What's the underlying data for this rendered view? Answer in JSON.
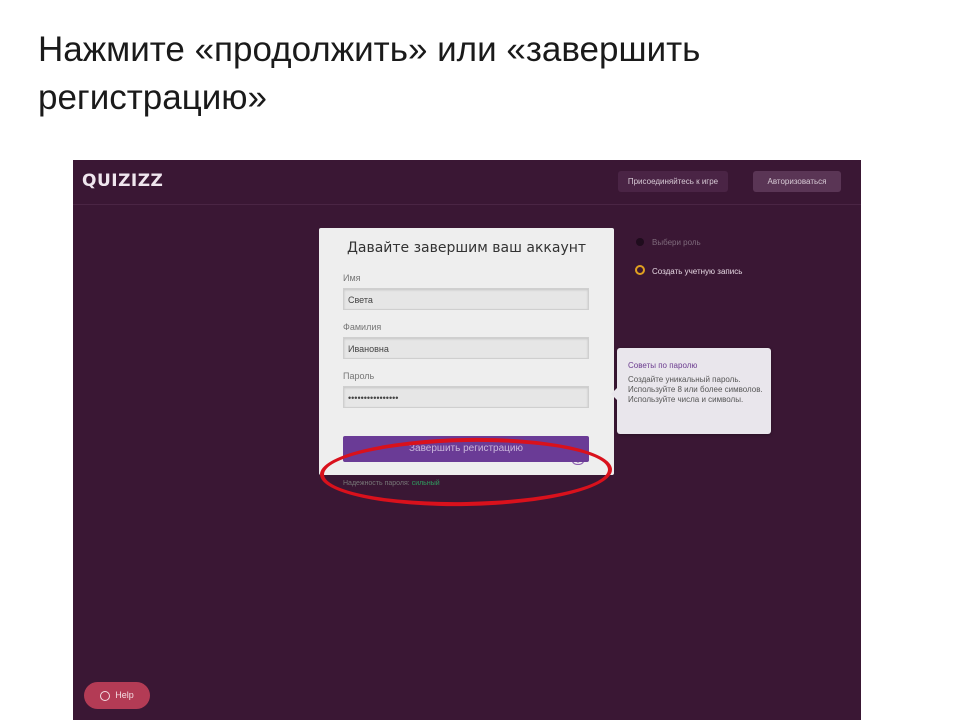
{
  "slide": {
    "title": "Нажмите «продолжить» или  «завершить регистрацию»"
  },
  "app": {
    "logo": "QUIZIZZ",
    "join_button": "Присоединяйтесь к игре",
    "login_button": "Авторизоваться"
  },
  "form": {
    "title": "Давайте завершим ваш аккаунт",
    "first_name_label": "Имя",
    "first_name_value": "Света",
    "last_name_label": "Фамилия",
    "last_name_value": "Ивановна",
    "password_label": "Пароль",
    "password_value": "••••••••••••••••",
    "strength_label": "Надежность пароля:",
    "strength_value": "сильный",
    "submit_button": "Завершить регистрацию",
    "eye_icon": "eye-icon"
  },
  "steps": [
    {
      "label": "Выбери роль"
    },
    {
      "label": "Создать учетную запись"
    }
  ],
  "password_tips": {
    "title": "Советы по паролю",
    "body": "Создайте уникальный пароль. Используйте 8 или более символов. Используйте числа и символы."
  },
  "help": {
    "label": "Help"
  },
  "colors": {
    "background": "#3a1734",
    "accent": "#6a3b96",
    "annotation": "#d9111c"
  }
}
